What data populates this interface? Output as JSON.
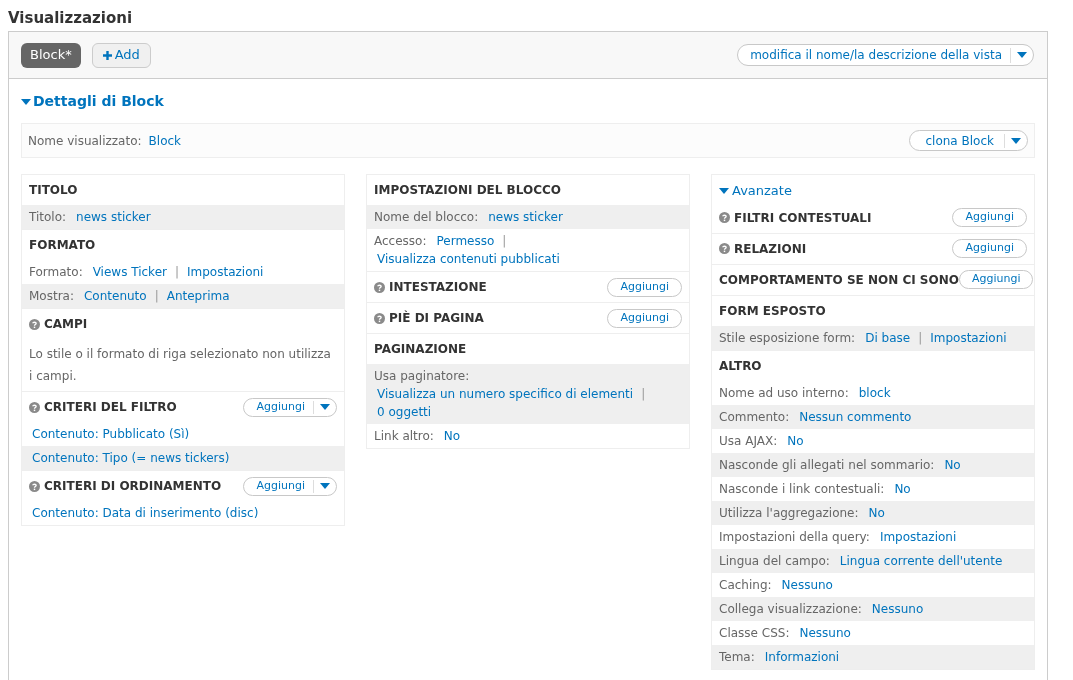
{
  "page_title": "Visualizzazioni",
  "display_tabs": [
    {
      "label": "Block*",
      "selected": true
    }
  ],
  "add_display": {
    "label": "Add"
  },
  "edit_view_button": {
    "label": "modifica il nome/la descrizione della vista"
  },
  "details": {
    "title": "Dettagli di Block",
    "expanded": true,
    "display_name": {
      "label": "Nome visualizzato:",
      "value": "Block"
    },
    "clone_button": {
      "label": "clona Block"
    },
    "columns": [
      [
        {
          "title": "TITOLO",
          "help": false,
          "rows": [
            {
              "shaded": true,
              "label": "Titolo:",
              "parts": [
                {
                  "kind": "link",
                  "text": "news sticker"
                }
              ]
            }
          ]
        },
        {
          "title": "FORMATO",
          "help": false,
          "rows": [
            {
              "shaded": false,
              "label": "Formato:",
              "parts": [
                {
                  "kind": "link",
                  "text": "Views Ticker"
                },
                {
                  "kind": "sep",
                  "text": "|"
                },
                {
                  "kind": "link",
                  "text": "Impostazioni"
                }
              ]
            },
            {
              "shaded": true,
              "label": "Mostra:",
              "parts": [
                {
                  "kind": "link",
                  "text": "Contenuto"
                },
                {
                  "kind": "sep",
                  "text": "|"
                },
                {
                  "kind": "link",
                  "text": "Anteprima"
                }
              ]
            }
          ]
        },
        {
          "title": "CAMPI",
          "help": true,
          "rows": [
            {
              "shaded": false,
              "kind": "text",
              "text": "Lo stile o il formato di riga selezionato non utilizza i campi."
            }
          ]
        },
        {
          "title": "CRITERI DEL FILTRO",
          "help": true,
          "add": {
            "label": "Aggiungi",
            "dropdown": true
          },
          "rows": [
            {
              "shaded": false,
              "parts": [
                {
                  "kind": "link",
                  "text": "Contenuto: Pubblicato (Sì)"
                }
              ]
            },
            {
              "shaded": true,
              "parts": [
                {
                  "kind": "link",
                  "text": "Contenuto: Tipo (= news tickers)"
                }
              ]
            }
          ]
        },
        {
          "title": "CRITERI DI ORDINAMENTO",
          "help": true,
          "add": {
            "label": "Aggiungi",
            "dropdown": true
          },
          "rows": [
            {
              "shaded": false,
              "parts": [
                {
                  "kind": "link",
                  "text": "Contenuto: Data di inserimento (disc)"
                }
              ]
            }
          ]
        }
      ],
      [
        {
          "title": "IMPOSTAZIONI DEL BLOCCO",
          "help": false,
          "rows": [
            {
              "shaded": true,
              "label": "Nome del blocco:",
              "parts": [
                {
                  "kind": "link",
                  "text": "news sticker"
                }
              ]
            },
            {
              "shaded": false,
              "label": "Accesso:",
              "parts": [
                {
                  "kind": "link",
                  "text": "Permesso"
                },
                {
                  "kind": "sep",
                  "text": "|"
                },
                {
                  "kind": "link",
                  "text": "Visualizza contenuti pubblicati"
                }
              ]
            }
          ]
        },
        {
          "title": "INTESTAZIONE",
          "help": true,
          "add": {
            "label": "Aggiungi",
            "dropdown": false
          }
        },
        {
          "title": "PIÈ DI PAGINA",
          "help": true,
          "add": {
            "label": "Aggiungi",
            "dropdown": false
          }
        },
        {
          "title": "PAGINAZIONE",
          "help": false,
          "rows": [
            {
              "shaded": true,
              "label": "Usa paginatore:",
              "parts": [
                {
                  "kind": "link",
                  "text": "Visualizza un numero specifico di elementi"
                },
                {
                  "kind": "sep",
                  "text": "|"
                },
                {
                  "kind": "link",
                  "text": "0 oggetti"
                }
              ]
            },
            {
              "shaded": false,
              "label": "Link altro:",
              "parts": [
                {
                  "kind": "link",
                  "text": "No"
                }
              ]
            }
          ]
        }
      ],
      [
        {
          "kind": "toggle",
          "title": "Avanzate",
          "expanded": true
        },
        {
          "title": "FILTRI CONTESTUALI",
          "help": true,
          "add": {
            "label": "Aggiungi",
            "dropdown": false
          }
        },
        {
          "title": "RELAZIONI",
          "help": true,
          "add": {
            "label": "Aggiungi",
            "dropdown": false
          }
        },
        {
          "title": "COMPORTAMENTO SE NON CI SONO",
          "help": false,
          "add": {
            "label": "Aggiungi",
            "dropdown": false
          }
        },
        {
          "title": "FORM ESPOSTO",
          "help": false,
          "rows": [
            {
              "shaded": true,
              "label": "Stile esposizione form:",
              "parts": [
                {
                  "kind": "link",
                  "text": "Di base"
                },
                {
                  "kind": "sep",
                  "text": "|"
                },
                {
                  "kind": "link",
                  "text": "Impostazioni"
                }
              ]
            }
          ]
        },
        {
          "title": "ALTRO",
          "help": false,
          "rows": [
            {
              "shaded": false,
              "label": "Nome ad uso interno:",
              "parts": [
                {
                  "kind": "link",
                  "text": "block"
                }
              ]
            },
            {
              "shaded": true,
              "label": "Commento:",
              "parts": [
                {
                  "kind": "link",
                  "text": "Nessun commento"
                }
              ]
            },
            {
              "shaded": false,
              "label": "Usa AJAX:",
              "parts": [
                {
                  "kind": "link",
                  "text": "No"
                }
              ]
            },
            {
              "shaded": true,
              "label": "Nasconde gli allegati nel sommario:",
              "parts": [
                {
                  "kind": "link",
                  "text": "No"
                }
              ]
            },
            {
              "shaded": false,
              "label": "Nasconde i link contestuali:",
              "parts": [
                {
                  "kind": "link",
                  "text": "No"
                }
              ]
            },
            {
              "shaded": true,
              "label": "Utilizza l'aggregazione:",
              "parts": [
                {
                  "kind": "link",
                  "text": "No"
                }
              ]
            },
            {
              "shaded": false,
              "label": "Impostazioni della query:",
              "parts": [
                {
                  "kind": "link",
                  "text": "Impostazioni"
                }
              ]
            },
            {
              "shaded": true,
              "label": "Lingua del campo:",
              "parts": [
                {
                  "kind": "link",
                  "text": "Lingua corrente dell'utente"
                }
              ]
            },
            {
              "shaded": false,
              "label": "Caching:",
              "parts": [
                {
                  "kind": "link",
                  "text": "Nessuno"
                }
              ]
            },
            {
              "shaded": true,
              "label": "Collega visualizzazione:",
              "parts": [
                {
                  "kind": "link",
                  "text": "Nessuno"
                }
              ]
            },
            {
              "shaded": false,
              "label": "Classe CSS:",
              "parts": [
                {
                  "kind": "link",
                  "text": "Nessuno"
                }
              ]
            },
            {
              "shaded": true,
              "label": "Tema:",
              "parts": [
                {
                  "kind": "link",
                  "text": "Informazioni"
                }
              ]
            }
          ]
        }
      ]
    ]
  }
}
